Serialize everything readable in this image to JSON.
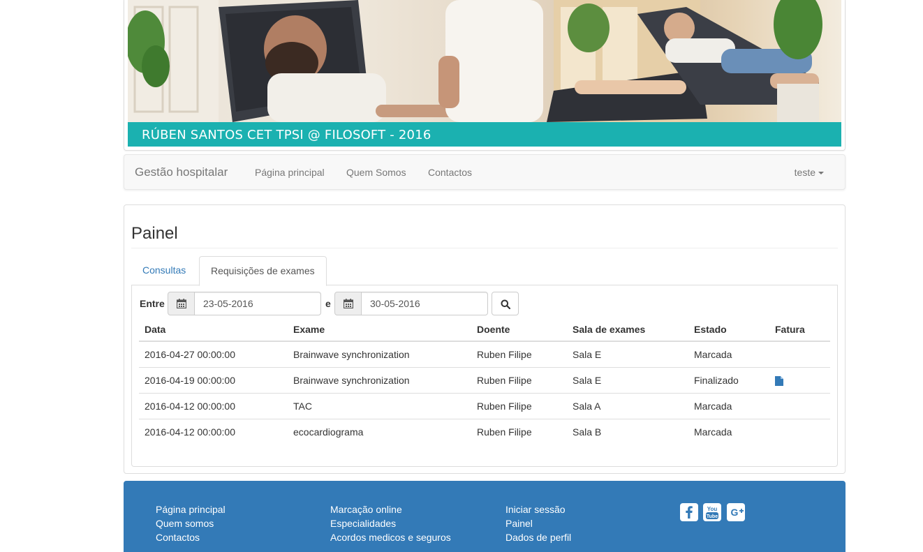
{
  "banner": {
    "caption": "RÚBEN SANTOS CET TPSI @ FILOSOFT - 2016"
  },
  "navbar": {
    "brand": "Gestão hospitalar",
    "links": [
      "Página principal",
      "Quem Somos",
      "Contactos"
    ],
    "user": "teste"
  },
  "main": {
    "title": "Painel",
    "tabs": [
      {
        "label": "Consultas",
        "active": false
      },
      {
        "label": "Requisições de exames",
        "active": true
      }
    ],
    "filter": {
      "between_label": "Entre",
      "and_label": "e",
      "from_date": "23-05-2016",
      "to_date": "30-05-2016",
      "search_icon": "search-icon",
      "calendar_icon": "calendar-icon"
    },
    "table": {
      "headers": [
        "Data",
        "Exame",
        "Doente",
        "Sala de exames",
        "Estado",
        "Fatura"
      ],
      "rows": [
        {
          "data": "2016-04-27 00:00:00",
          "exame": "Brainwave synchronization",
          "doente": "Ruben Filipe",
          "sala": "Sala E",
          "estado": "Marcada",
          "fatura": false
        },
        {
          "data": "2016-04-19 00:00:00",
          "exame": "Brainwave synchronization",
          "doente": "Ruben Filipe",
          "sala": "Sala E",
          "estado": "Finalizado",
          "fatura": true
        },
        {
          "data": "2016-04-12 00:00:00",
          "exame": "TAC",
          "doente": "Ruben Filipe",
          "sala": "Sala A",
          "estado": "Marcada",
          "fatura": false
        },
        {
          "data": "2016-04-12 00:00:00",
          "exame": "ecocardiograma",
          "doente": "Ruben Filipe",
          "sala": "Sala B",
          "estado": "Marcada",
          "fatura": false
        }
      ]
    }
  },
  "footer": {
    "col1": [
      "Página principal",
      "Quem somos",
      "Contactos"
    ],
    "col2": [
      "Marcação online",
      "Especialidades",
      "Acordos medicos e seguros"
    ],
    "col3": [
      "Iniciar sessão",
      "Painel",
      "Dados de perfil"
    ],
    "social": [
      "facebook-icon",
      "youtube-icon",
      "google-plus-icon"
    ]
  },
  "colors": {
    "caption_bg": "#1bb1b0",
    "footer_bg": "#337ab7",
    "link": "#337ab7"
  }
}
